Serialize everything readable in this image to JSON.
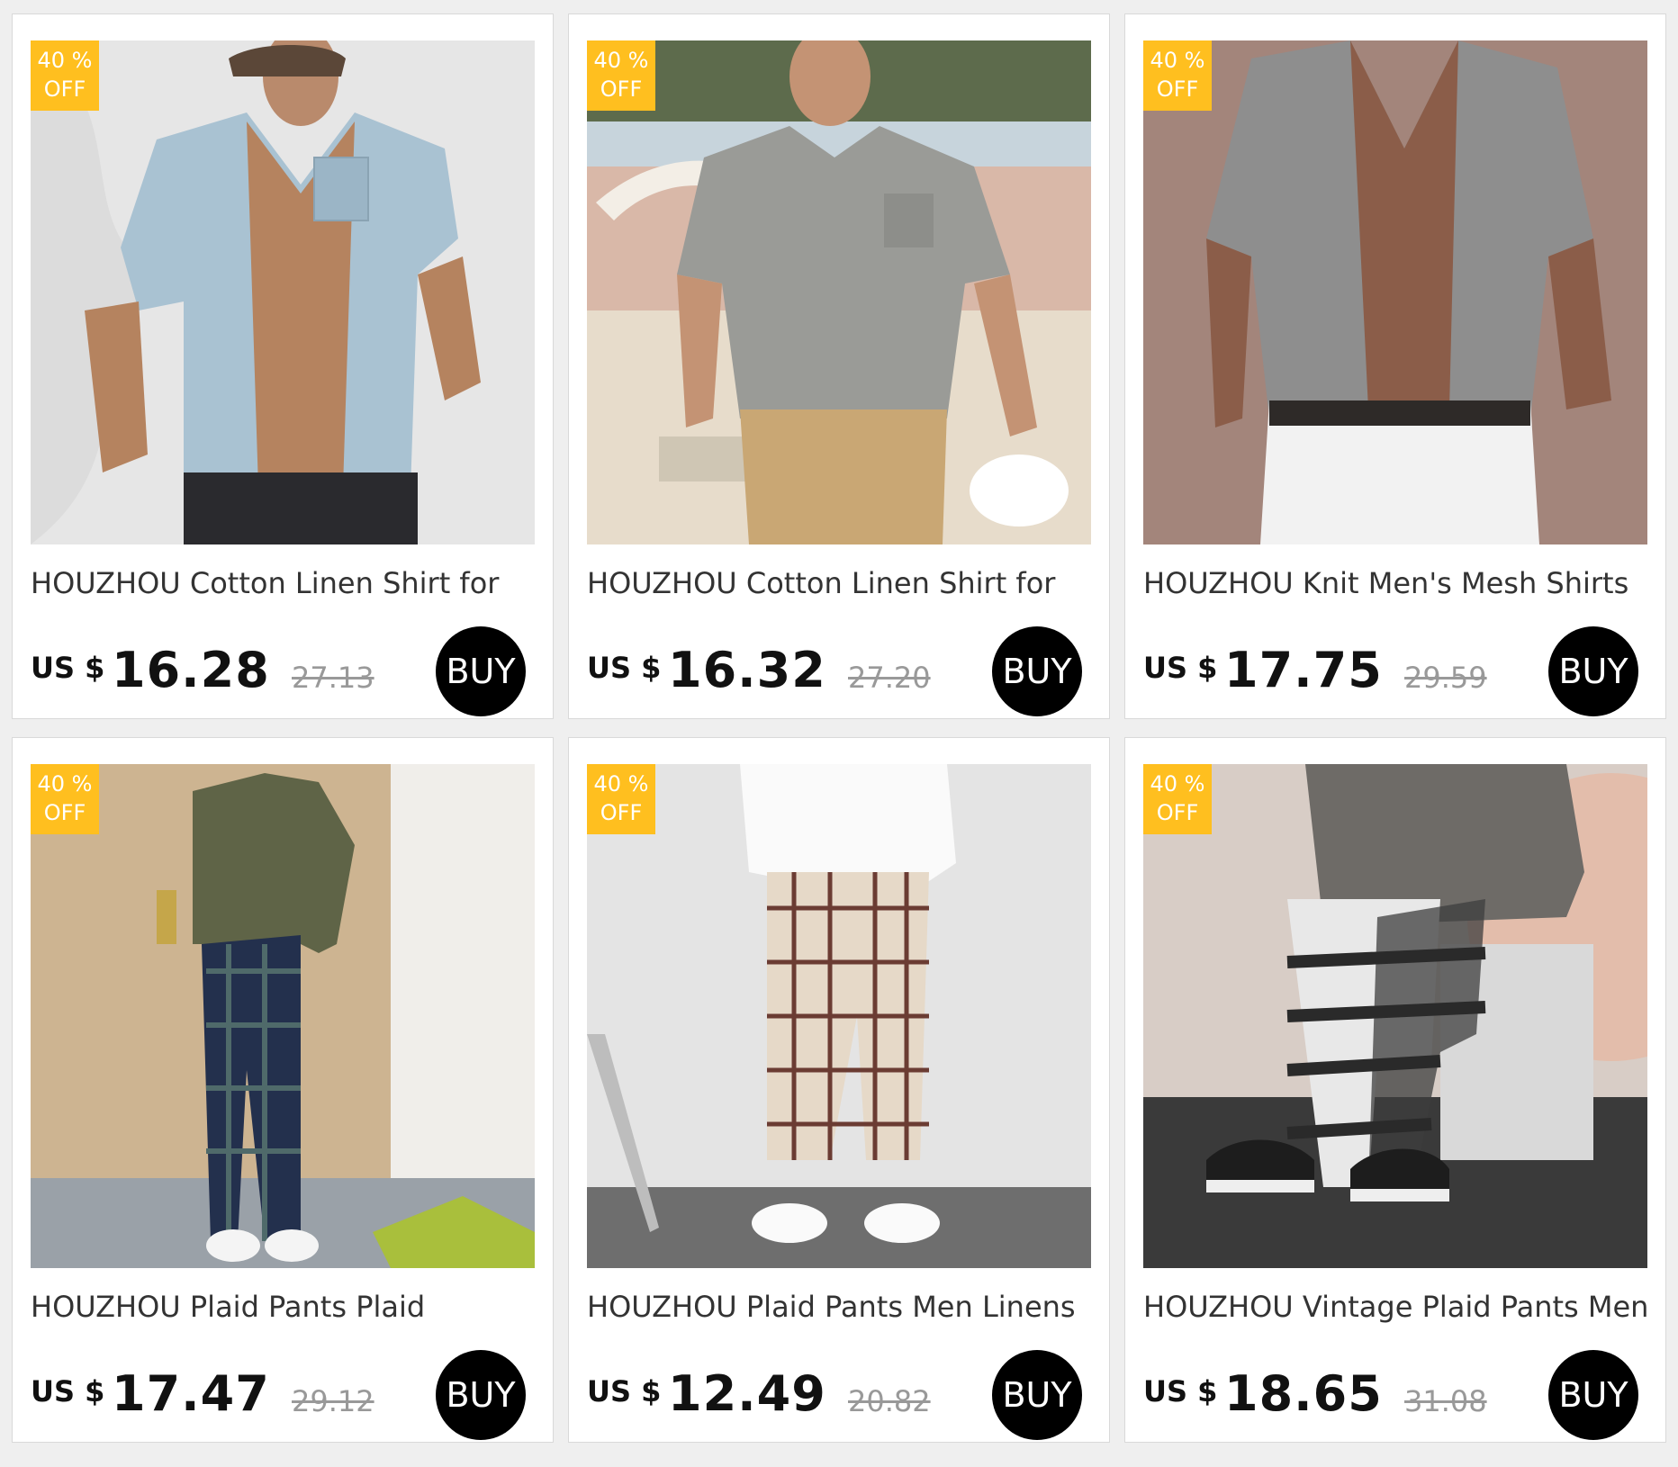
{
  "badge": {
    "line1": "40 %",
    "line2": "OFF"
  },
  "currency_label": "US $",
  "buy_label": "BUY",
  "products": [
    {
      "title": "HOUZHOU Cotton Linen Shirt for",
      "price": "16.28",
      "original_price": "27.13",
      "image": "man-light-blue-linen-shirt-open"
    },
    {
      "title": "HOUZHOU Cotton Linen Shirt for",
      "price": "16.32",
      "original_price": "27.20",
      "image": "man-grey-linen-shirt-khaki-pants-beach"
    },
    {
      "title": "HOUZHOU Knit Men's Mesh Shirts",
      "price": "17.75",
      "original_price": "29.59",
      "image": "man-grey-knit-mesh-shirt-white-jeans"
    },
    {
      "title": "HOUZHOU Plaid Pants Plaid",
      "price": "17.47",
      "original_price": "29.12",
      "image": "navy-plaid-pants-olive-sweater"
    },
    {
      "title": "HOUZHOU Plaid Pants Men Linens",
      "price": "12.49",
      "original_price": "20.82",
      "image": "cream-plaid-pants-white-shirt"
    },
    {
      "title": "HOUZHOU Vintage Plaid Pants Men",
      "price": "18.65",
      "original_price": "31.08",
      "image": "black-white-plaid-pants-grey-sweatshirt"
    }
  ],
  "colors": {
    "badge": "#ffbf1f",
    "buy_button": "#000000",
    "page_bg": "#efefef"
  }
}
